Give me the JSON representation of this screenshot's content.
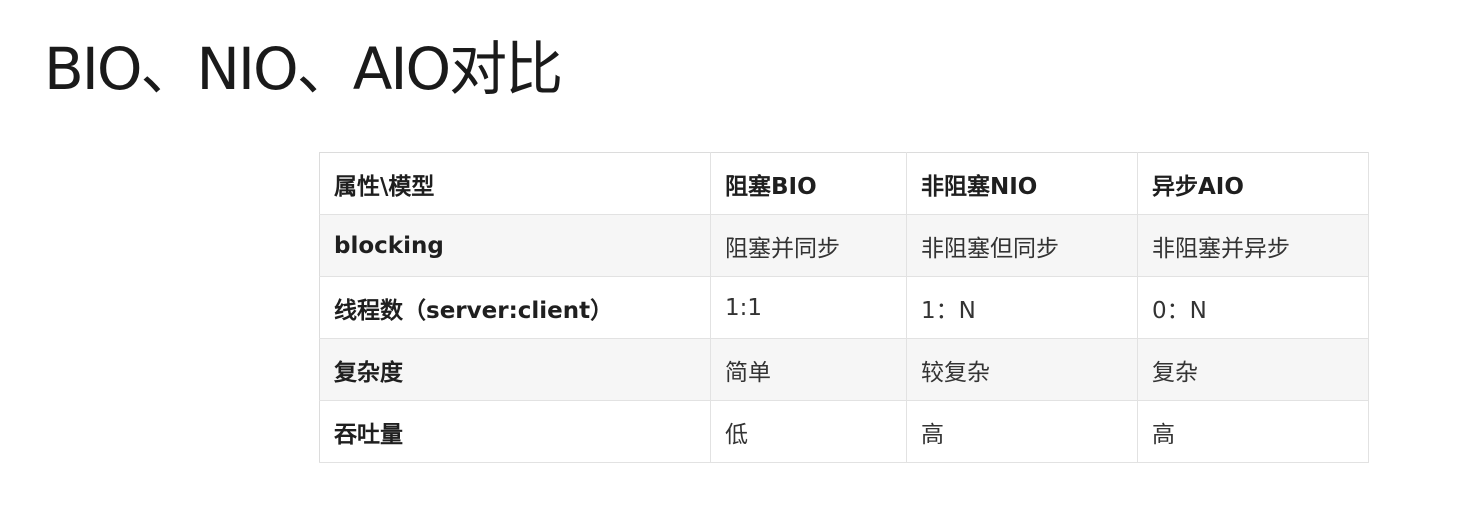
{
  "title": "BIO、NIO、AIO对比",
  "table": {
    "headers": [
      "属性\\模型",
      "阻塞BIO",
      "非阻塞NIO",
      "异步AIO"
    ],
    "rows": [
      [
        "blocking",
        "阻塞并同步",
        "非阻塞但同步",
        "非阻塞并异步"
      ],
      [
        "线程数（server:client）",
        "1:1",
        "1：N",
        "0：N"
      ],
      [
        "复杂度",
        "简单",
        "较复杂",
        "复杂"
      ],
      [
        "吞吐量",
        "低",
        "高",
        "高"
      ]
    ]
  }
}
